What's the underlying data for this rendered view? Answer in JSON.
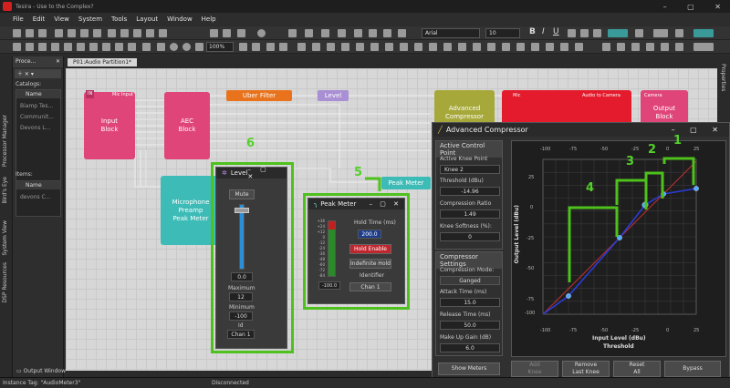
{
  "app": {
    "title": "Tesira - Use to the Complex?"
  },
  "menu": [
    "File",
    "Edit",
    "View",
    "System",
    "Tools",
    "Layout",
    "Window",
    "Help"
  ],
  "toolbar": {
    "zoom": "100%",
    "font": "Arial",
    "font_size": "10",
    "bold": "B",
    "italic": "I",
    "underline": "U"
  },
  "left_panel": {
    "title": "Proce...",
    "catalogs_label": "Catalogs:",
    "name_header": "Name",
    "catalog_items": [
      "Biamp Tes...",
      "Communit...",
      "Devons L..."
    ],
    "items_label": "Items:",
    "item_name_header": "Name",
    "items": [
      "devons C..."
    ],
    "side_tabs": [
      "Processor Manager",
      "Bird's Eye",
      "System View",
      "DSP Resources"
    ]
  },
  "doc_tab": "P01:Audio Partition1*",
  "blocks": {
    "input": {
      "top": "Mic Input",
      "name": "Input\nBlock"
    },
    "aec": {
      "name": "AEC\nBlock"
    },
    "uber": {
      "name": "Uber Filter"
    },
    "level": {
      "name": "Level"
    },
    "advcomp": {
      "name": "Advanced\nCompressor"
    },
    "mic": {
      "top": "Mic",
      "right": "Audio to Camera"
    },
    "camera": {
      "top": "Camera",
      "name": "Output\nBlock"
    },
    "preamp": {
      "name": "Microphone\nPreamp\nPeak Meter"
    },
    "peak_small": {
      "name": "Peak Meter"
    }
  },
  "level_dialog": {
    "title": "Level",
    "mute": "Mute",
    "value": "0.0",
    "max_label": "Maximum",
    "max_value": "12",
    "min_label": "Minimum",
    "min_value": "-100",
    "id_label": "Id",
    "id_value": "Chan 1"
  },
  "peak_dialog": {
    "title": "Peak Meter",
    "hold_label": "Hold Time (ms)",
    "hold_value": "200.0",
    "hold_enable": "Hold Enable",
    "indef": "Indefinite Hold",
    "identifier": "Identifier",
    "chan": "Chan 1",
    "meter_value": "-100.0",
    "scale": [
      "+36",
      "+24",
      "+12",
      "0",
      "-12",
      "-24",
      "-36",
      "-48",
      "-60",
      "-72",
      "-84"
    ]
  },
  "comp_dialog": {
    "title": "Advanced Compressor",
    "active_cp": "Active Control Point",
    "akp_label": "Active Knee Point",
    "akp_value": "Knee 2",
    "thr_label": "Threshold (dBu)",
    "thr_value": "-14.96",
    "ratio_label": "Compression Ratio",
    "ratio_value": "1.49",
    "soft_label": "Knee Softness (%):",
    "soft_value": "0",
    "settings": "Compressor Settings",
    "mode_label": "Compression Mode:",
    "mode_value": "Ganged",
    "attack_label": "Attack Time (ms)",
    "attack_value": "15.0",
    "release_label": "Release Time (ms)",
    "release_value": "50.0",
    "makeup_label": "Make Up Gain (dB)",
    "makeup_value": "6.0",
    "show_meters": "Show Meters",
    "add_knee": "Add\nKnee",
    "remove_knee": "Remove\nLast Knee",
    "reset_all": "Reset\nAll",
    "bypass": "Bypass",
    "xlabel": "Input Level (dBu)",
    "xlabel2": "Threshold",
    "ylabel": "Output Level (dBu)",
    "xticks": [
      "-100",
      "-75",
      "-50",
      "-25",
      "0",
      "25"
    ],
    "yticks": [
      "25",
      "0",
      "-25",
      "-50",
      "-75",
      "-100"
    ]
  },
  "annotations": [
    "1",
    "2",
    "3",
    "4",
    "5",
    "6"
  ],
  "status": {
    "instance": "Instance Tag: \"AudioMeter3\"",
    "conn": "Disconnected",
    "output_tab": "Output Window"
  },
  "right_tab": "Properties",
  "colors": {
    "pink": "#e0457a",
    "red": "#e31b2c",
    "olive": "#a7a83a",
    "orange": "#e8731c",
    "teal": "#3dbbb6",
    "green_annot": "#4ec11c"
  }
}
